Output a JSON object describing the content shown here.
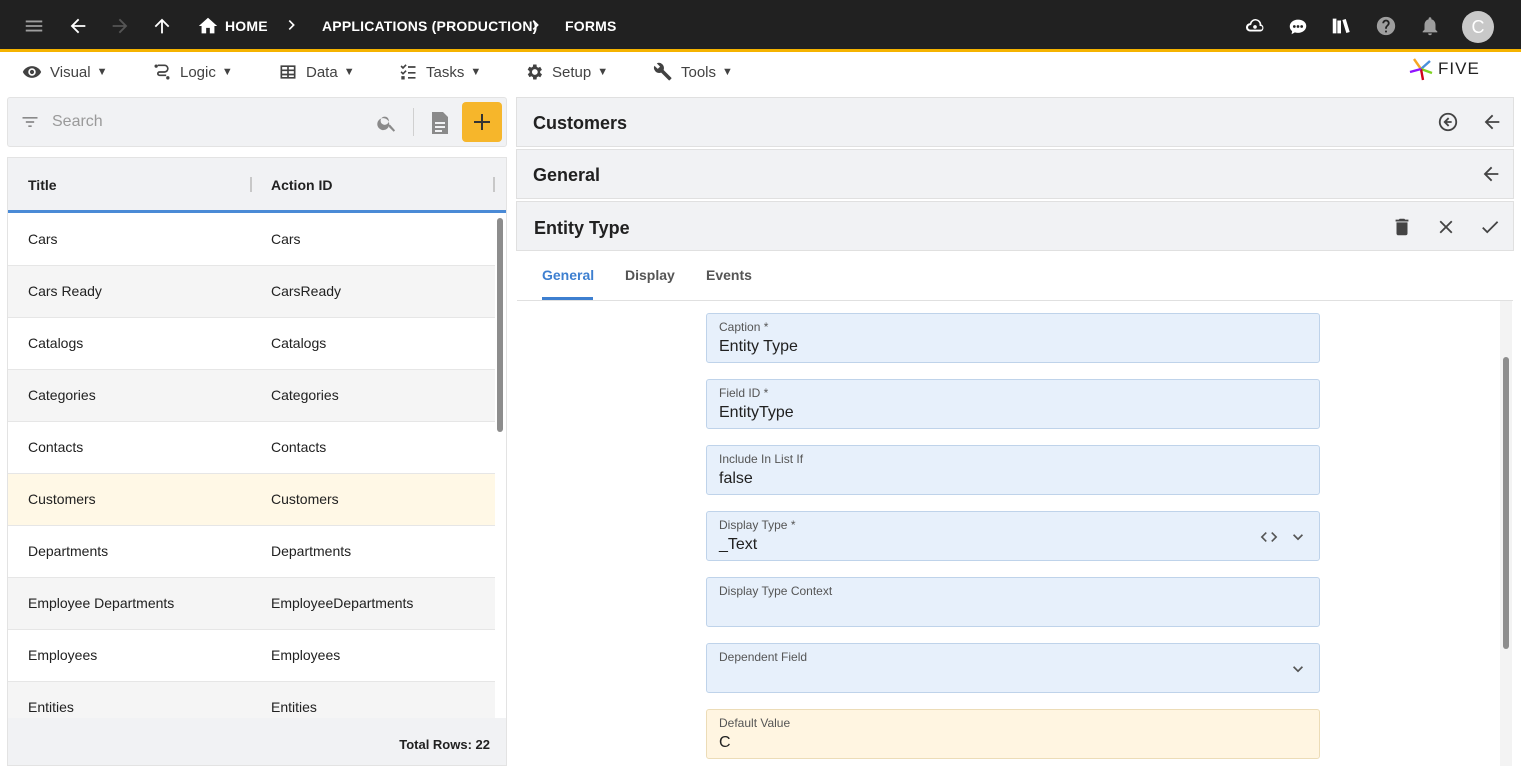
{
  "topbar": {
    "breadcrumbs": [
      {
        "label": "HOME"
      },
      {
        "label": "APPLICATIONS (PRODUCTION)"
      },
      {
        "label": "FORMS"
      }
    ],
    "avatar_initial": "C",
    "accent_color": "#f5b300",
    "icons": [
      "menu-icon",
      "back-arrow-icon",
      "forward-arrow-icon",
      "up-arrow-icon",
      "home-icon",
      "cloud-sync-icon",
      "chat-bot-icon",
      "library-icon",
      "help-icon",
      "bell-icon"
    ]
  },
  "menubar": {
    "items": [
      {
        "label": "Visual",
        "icon": "eye-icon"
      },
      {
        "label": "Logic",
        "icon": "logic-icon"
      },
      {
        "label": "Data",
        "icon": "table-icon"
      },
      {
        "label": "Tasks",
        "icon": "checklist-icon"
      },
      {
        "label": "Setup",
        "icon": "gear-icon"
      },
      {
        "label": "Tools",
        "icon": "tools-icon"
      }
    ],
    "caret": "▼",
    "logo_text": "FIVE"
  },
  "search": {
    "placeholder": "Search"
  },
  "list": {
    "columns": [
      "Title",
      "Action ID"
    ],
    "rows": [
      {
        "title": "Cars",
        "action_id": "Cars"
      },
      {
        "title": "Cars Ready",
        "action_id": "CarsReady"
      },
      {
        "title": "Catalogs",
        "action_id": "Catalogs"
      },
      {
        "title": "Categories",
        "action_id": "Categories"
      },
      {
        "title": "Contacts",
        "action_id": "Contacts"
      },
      {
        "title": "Customers",
        "action_id": "Customers"
      },
      {
        "title": "Departments",
        "action_id": "Departments"
      },
      {
        "title": "Employee Departments",
        "action_id": "EmployeeDepartments"
      },
      {
        "title": "Employees",
        "action_id": "Employees"
      },
      {
        "title": "Entities",
        "action_id": "Entities"
      }
    ],
    "selected_row": "Customers",
    "total_rows": "Total Rows: 22",
    "header_accent": "#4a8ad6",
    "add_button_color": "#f6b62b"
  },
  "panels": {
    "form_title": "Customers",
    "page_title": "General",
    "field_title": "Entity Type"
  },
  "tabs": [
    {
      "label": "General",
      "active": true
    },
    {
      "label": "Display",
      "active": false
    },
    {
      "label": "Events",
      "active": false
    }
  ],
  "form": {
    "fields": [
      {
        "label": "Caption *",
        "value": "Entity Type"
      },
      {
        "label": "Field ID *",
        "value": "EntityType"
      },
      {
        "label": "Include In List If",
        "value": "false"
      },
      {
        "label": "Display Type *",
        "value": "_Text"
      },
      {
        "label": "Display Type Context",
        "value": ""
      },
      {
        "label": "Dependent Field",
        "value": ""
      },
      {
        "label": "Default Value",
        "value": "C"
      }
    ]
  }
}
